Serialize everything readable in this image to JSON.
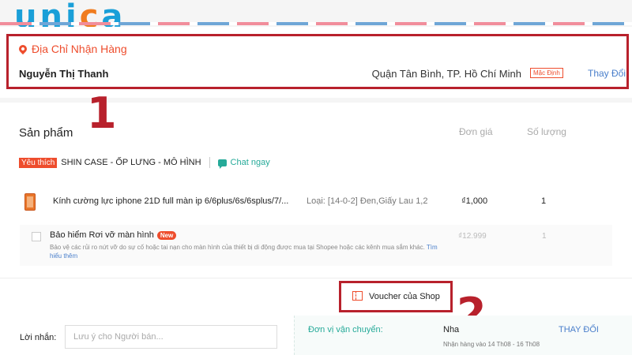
{
  "logo": {
    "part1": "u",
    "part2": "n",
    "part3": "i",
    "part4": "c",
    "part5": "a"
  },
  "colors": {
    "accent": "#ee4d2d",
    "annotation": "#b8212c",
    "teal": "#26aa99",
    "link": "#4a7fcb"
  },
  "address": {
    "title": "Địa Chỉ Nhận Hàng",
    "name": "Nguyễn Thị Thanh",
    "location": "Quận Tân Bình, TP. Hồ Chí Minh",
    "default_badge": "Mặc Định",
    "change_label": "Thay Đổi"
  },
  "annotations": {
    "one": "1",
    "two": "2"
  },
  "products": {
    "title": "Sản phẩm",
    "col_price": "Đơn giá",
    "col_qty": "Số lượng",
    "shop": {
      "fav_tag": "Yêu thích",
      "name": "SHIN CASE - ỐP LƯNG - MÔ HÌNH",
      "chat": "Chat ngay"
    },
    "items": [
      {
        "name": "Kính cường lực iphone 21D full màn ip 6/6plus/6s/6splus/7/...",
        "variant": "Loại: [14-0-2] Đen,Giấy Lau 1,2",
        "price": "₫1,000",
        "qty": "1"
      }
    ],
    "insurance": {
      "title": "Bảo hiểm Rơi vỡ màn hình",
      "new_badge": "New",
      "desc": "Bảo vệ các rủi ro nứt vỡ do sự cố hoặc tai nạn cho màn hình của thiết bị di động được mua tại Shopee hoặc các kênh mua sắm khác.",
      "more": "Tìm hiểu thêm",
      "price": "₫12.999",
      "qty": "1"
    }
  },
  "voucher": {
    "label": "Voucher của Shop"
  },
  "bottom": {
    "msg_label": "Lời nhắn:",
    "msg_placeholder": "Lưu ý cho Người bán...",
    "ship_label": "Đơn vị vận chuyển:",
    "ship_name": "Nha",
    "ship_change": "THAY ĐỔI",
    "ship_date": "Nhận hàng vào 14 Th08 - 16 Th08"
  }
}
